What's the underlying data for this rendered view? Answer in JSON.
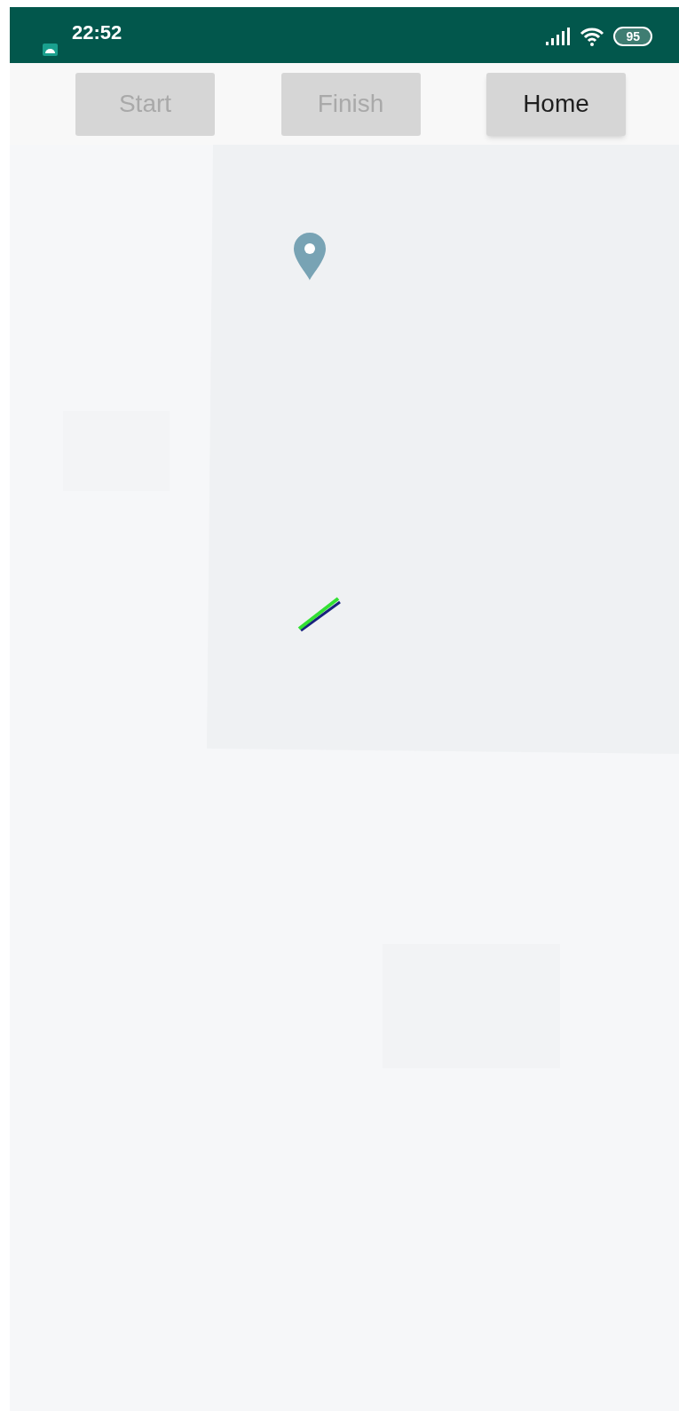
{
  "status_bar": {
    "time": "22:52",
    "battery": "95"
  },
  "buttons": [
    {
      "label": "Start",
      "disabled": true
    },
    {
      "label": "Finish",
      "disabled": true
    },
    {
      "label": "Home",
      "disabled": false
    }
  ]
}
